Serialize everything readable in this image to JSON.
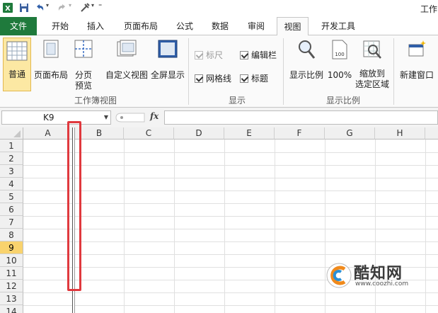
{
  "qat": {
    "window_title": "工作"
  },
  "tabs": [
    {
      "label": "文件"
    },
    {
      "label": "开始"
    },
    {
      "label": "插入"
    },
    {
      "label": "页面布局"
    },
    {
      "label": "公式"
    },
    {
      "label": "数据"
    },
    {
      "label": "审阅"
    },
    {
      "label": "视图",
      "active": true
    },
    {
      "label": "开发工具"
    }
  ],
  "ribbon": {
    "workbook_views": {
      "label": "工作簿视图",
      "buttons": [
        {
          "label": "普通",
          "active": true
        },
        {
          "label": "页面布局"
        },
        {
          "label": "分页",
          "label2": "预览"
        },
        {
          "label": "自定义视图"
        },
        {
          "label": "全屏显示"
        }
      ]
    },
    "show": {
      "label": "显示",
      "items": [
        {
          "label": "标尺",
          "checked": true,
          "disabled": true
        },
        {
          "label": "编辑栏",
          "checked": true
        },
        {
          "label": "网格线",
          "checked": true
        },
        {
          "label": "标题",
          "checked": true
        }
      ]
    },
    "zoom": {
      "label": "显示比例",
      "buttons": [
        {
          "label": "显示比例"
        },
        {
          "label": "100%"
        },
        {
          "label": "缩放到",
          "label2": "选定区域"
        }
      ]
    },
    "window": {
      "buttons": [
        {
          "label": "新建窗口"
        }
      ]
    }
  },
  "formula_bar": {
    "name_box": "K9",
    "fx": "fx",
    "value": ""
  },
  "sheet": {
    "columns": [
      "A",
      "B",
      "C",
      "D",
      "E",
      "F",
      "G",
      "H"
    ],
    "rows": [
      "1",
      "2",
      "3",
      "4",
      "5",
      "6",
      "7",
      "8",
      "9",
      "10",
      "11",
      "12",
      "13",
      "14"
    ],
    "selected_row": "9"
  },
  "watermark": {
    "name": "酷知网",
    "url": "www.coozhi.com"
  },
  "colors": {
    "file_tab": "#1f7a3c",
    "highlight": "#e0393e",
    "selected_row": "#f9d36e"
  }
}
